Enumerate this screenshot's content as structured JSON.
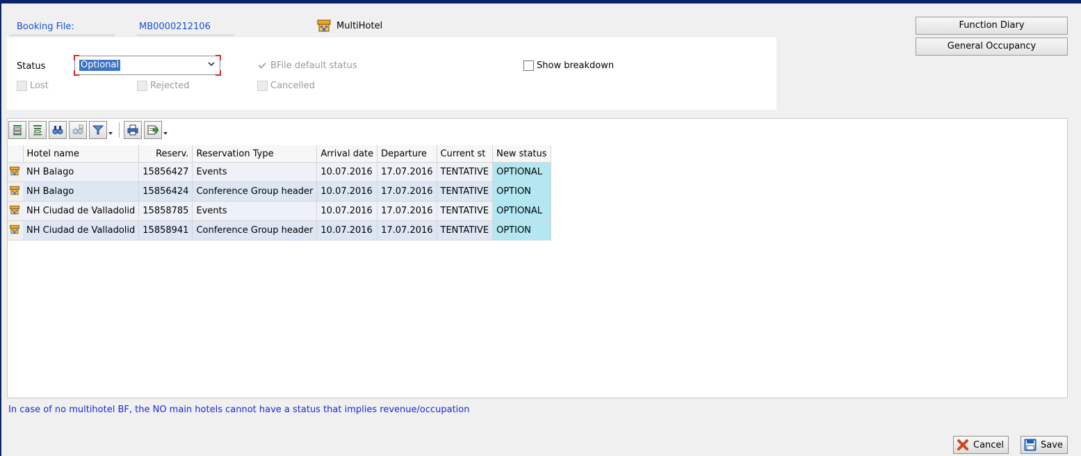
{
  "header": {
    "booking_file_label": "Booking File:",
    "booking_file_value": "MB0000212106",
    "multihotel_label": "MultiHotel",
    "multihotel_icon": "hotel-icon"
  },
  "side_buttons": {
    "function_diary": "Function Diary",
    "general_occupancy": "General Occupancy"
  },
  "status_panel": {
    "status_label": "Status",
    "status_selected": "Optional",
    "checkboxes": {
      "bfile_default_status": {
        "label": "BFile default status",
        "checked": true,
        "enabled": false
      },
      "show_breakdown": {
        "label": "Show breakdown",
        "checked": false,
        "enabled": true
      },
      "lost": {
        "label": "Lost",
        "checked": false,
        "enabled": false
      },
      "rejected": {
        "label": "Rejected",
        "checked": false,
        "enabled": false
      },
      "cancelled": {
        "label": "Cancelled",
        "checked": false,
        "enabled": false
      }
    }
  },
  "toolbar": {
    "icons": [
      "align-top-icon",
      "align-bottom-icon",
      "find-icon",
      "find-next-icon",
      "filter-icon",
      "print-icon",
      "export-icon"
    ]
  },
  "grid": {
    "columns": [
      "Hotel name",
      "Reserv.",
      "Reservation Type",
      "Arrival date",
      "Departure",
      "Current st",
      "New status"
    ],
    "rows": [
      [
        "NH Balago",
        "15856427",
        "Events",
        "10.07.2016",
        "17.07.2016",
        "TENTATIVE",
        "OPTIONAL"
      ],
      [
        "NH Balago",
        "15856424",
        "Conference Group header",
        "10.07.2016",
        "17.07.2016",
        "TENTATIVE",
        "OPTION"
      ],
      [
        "NH Ciudad de Valladolid",
        "15858785",
        "Events",
        "10.07.2016",
        "17.07.2016",
        "TENTATIVE",
        "OPTIONAL"
      ],
      [
        "NH Ciudad de Valladolid",
        "15858941",
        "Conference Group header",
        "10.07.2016",
        "17.07.2016",
        "TENTATIVE",
        "OPTION"
      ]
    ]
  },
  "message": "In case of no multihotel BF, the NO main hotels cannot have a status that implies revenue/occupation",
  "footer": {
    "cancel_label": "Cancel",
    "save_label": "Save"
  },
  "colors": {
    "link_blue": "#1a4fd0",
    "message_blue": "#1a28d8",
    "new_status_bg": "#b3e8f2",
    "row_alt_bg": "#dde6f3"
  }
}
